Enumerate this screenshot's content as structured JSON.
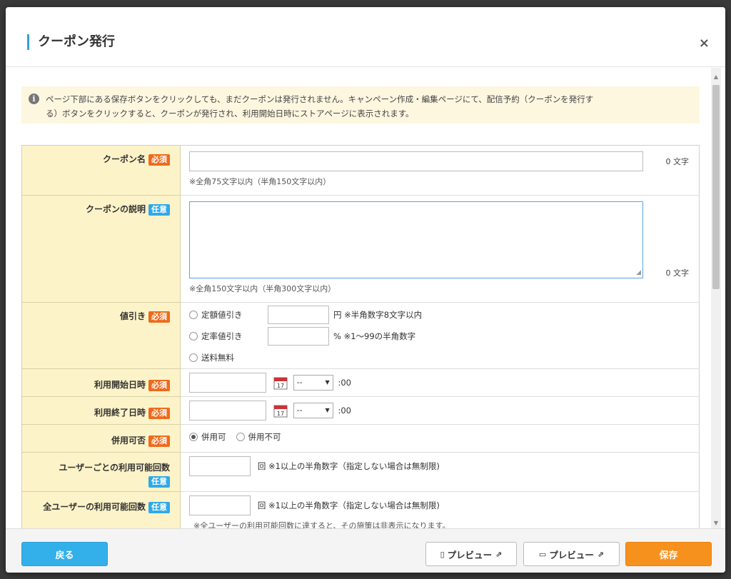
{
  "modal": {
    "title": "クーポン発行",
    "close": "×"
  },
  "info": {
    "icon": "i",
    "text_line1": "ページ下部にある保存ボタンをクリックしても、まだクーポンは発行されません。キャンペーン作成・編集ページにて、配信予約（クーポンを発行す",
    "text_line2": "る）ボタンをクリックすると、クーポンが発行され、利用開始日時にストアページに表示されます。"
  },
  "badges": {
    "required": "必須",
    "optional": "任意"
  },
  "fields": {
    "coupon_name": {
      "label": "クーポン名",
      "value": "",
      "note": "※全角75文字以内（半角150文字以内）",
      "count": "0 文字"
    },
    "coupon_desc": {
      "label": "クーポンの説明",
      "value": "",
      "note": "※全角150文字以内（半角300文字以内）",
      "count": "0 文字"
    },
    "discount": {
      "label": "値引き",
      "opt1": "定額値引き",
      "opt1_unit": "円 ※半角数字8文字以内",
      "opt2": "定率値引き",
      "opt2_unit": "% ※1〜99の半角数字",
      "opt3": "送料無料"
    },
    "start_datetime": {
      "label": "利用開始日時",
      "hour": "--",
      "minute": ":00"
    },
    "end_datetime": {
      "label": "利用終了日時",
      "hour": "--",
      "minute": ":00"
    },
    "combinable": {
      "label": "併用可否",
      "opt1": "併用可",
      "opt2": "併用不可",
      "selected": "併用可"
    },
    "per_user_limit": {
      "label": "ユーザーごとの利用可能回数",
      "unit": "回 ※1以上の半角数字（指定しない場合は無制限)"
    },
    "all_user_limit": {
      "label": "全ユーザーの利用可能回数",
      "unit": "回 ※1以上の半角数字（指定しない場合は無制限)",
      "note": "※全ユーザーの利用可能回数に達すると、その施策は非表示になります。"
    }
  },
  "footer": {
    "back": "戻る",
    "preview_mobile": "プレビュー",
    "preview_pc": "プレビュー",
    "save": "保存"
  },
  "colors": {
    "accent": "#33a1d8",
    "required_badge": "#ef6a1c",
    "optional_badge": "#2fa9e8",
    "save": "#f7911e",
    "label_bg": "#fdf3c8"
  }
}
